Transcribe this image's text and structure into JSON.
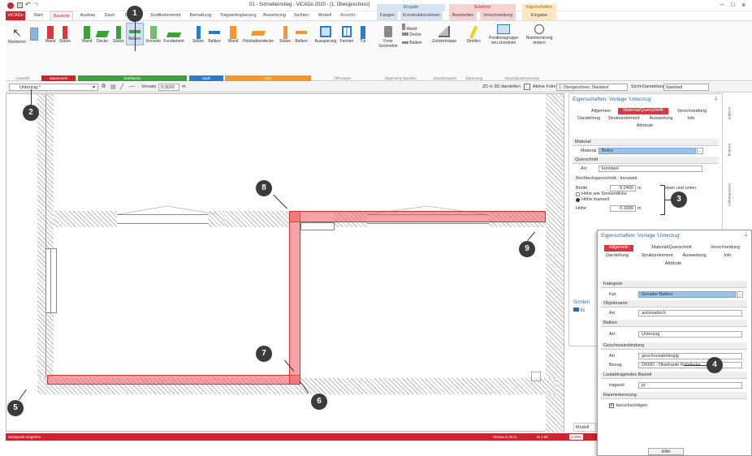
{
  "window": {
    "title": "01 - Schnelleinstieg - ViCADo 2020 - [1. Obergeschoss]",
    "controls": [
      "–",
      "□",
      "×"
    ]
  },
  "tabs": [
    "ViCADo",
    "Start",
    "Bauteile",
    "Ausbau",
    "Dach",
    "Gelände",
    "Grafikelemente",
    "Bemaßung",
    "Tragwerksplanung",
    "Bewehrung",
    "Sichten",
    "Modell",
    "Ansicht",
    "Fangen",
    "Konstruktionslinien",
    "Bearbeiten",
    "Verschneidung",
    "Eingabe"
  ],
  "context_groups": [
    {
      "label": "Eingabe"
    },
    {
      "label": "Selektion"
    },
    {
      "label": "Eigenschaften"
    }
  ],
  "ribbon": {
    "buttons": [
      "Markieren",
      "Wand",
      "Stütze",
      "Wand",
      "Decke",
      "Stütze",
      "Balken",
      "Konsole",
      "Fundament",
      "Stütze",
      "Balken",
      "Wand",
      "Holzbalkendecke",
      "Stütze",
      "Balken",
      "Aussparung",
      "Fenster",
      "Tür",
      "Freie Geometrie",
      "Wand",
      "Decke",
      "Balken",
      "Zahnbrtreppe",
      "Streifen",
      "Positionsgruppe neu zuordnen",
      "Nummerierung ändern"
    ],
    "groups": [
      "Auswahl",
      "Mauerwerk",
      "Stahlbeton",
      "Stahl",
      "Holz",
      "Öffnungen",
      "Allgemeine Bauteile",
      "Zusatztreppen",
      "Dämmung",
      "Bauteilpositionierung"
    ]
  },
  "toolbar2": {
    "vorlage": "Unterzug *",
    "versatz_label": "Versatz",
    "versatz_value": "0.0000",
    "unit": "m",
    "show3d": "2D in 3D darstellen",
    "folie_label": "Aktive Folie:",
    "folie_value": "1. Obergeschoss: Standard",
    "sicht_label": "Sicht-Darstellung:",
    "sicht_value": "Standard"
  },
  "status": {
    "left": "Startpunkt eingeben",
    "niveau": "Niveau 2,75 m",
    "scale": "M 1:50",
    "extra": "1:10%"
  },
  "panel1": {
    "title": "Eigenschaften: Vorlage 'Unterzug'",
    "tabs": [
      "Allgemein",
      "Material/Querschnitt",
      "Verschneidung",
      "Darstellung",
      "Strukturelement",
      "Auswertung",
      "Info",
      "Attribute"
    ],
    "sec_material": "Material",
    "material_label": "Material",
    "material_value": "Beton",
    "sec_querschnitt": "Querschnitt",
    "art_label": "Art",
    "art_value": "konstant",
    "rq_label": "Rechteckquerschnitt - konstant",
    "breite_label": "Breite",
    "breite_value": "0.2400",
    "breite_unit": "m",
    "opt_decke": "Höhe wie Deckendicke",
    "opt_manuell": "Höhe manuell",
    "hoehe_label": "Höhe",
    "hoehe_value": "0.3000",
    "hoehe_unit": "m",
    "oben_unten": "oben und unten"
  },
  "panel2": {
    "title": "Eigenschaften: Vorlage 'Unterzug'",
    "tabs": [
      "Allgemein",
      "Material/Querschnitt",
      "Verschneidung",
      "Darstellung",
      "Strukturelement",
      "Auswertung",
      "Info",
      "Attribute"
    ],
    "sec_kategorie": "Kategorie",
    "kat_label": "Kat",
    "kat_value": "Gerader Balken",
    "sec_objektname": "Objektname",
    "obj_art_label": "Art",
    "obj_art_value": "automatisch",
    "sec_balken": "Balken",
    "balken_art_label": "Art",
    "balken_art_value": "Unterzug",
    "sec_geschoss": "Geschossanbindung",
    "gesch_art_label": "Art",
    "gesch_art_value": "geschossabhängig",
    "bezug_label": "Bezug",
    "bezug_value": "OKRD - Oberkante Rohdecke",
    "sec_last": "Lastabtragendes Bauteil",
    "tragend_label": "tragend",
    "tragend_value": "ja",
    "sec_raum": "Raumerkennung",
    "raum_check": "berücksichtigen",
    "hilfe": "Hilfe"
  },
  "sichten": {
    "title": "Sichten",
    "item": "01"
  },
  "modell_tab": "Modell",
  "side_tabs": [
    "Cockpit",
    "Katalog",
    "Anmerkungen"
  ],
  "badges": [
    "1",
    "2",
    "3",
    "4",
    "5",
    "6",
    "7",
    "8",
    "9"
  ]
}
